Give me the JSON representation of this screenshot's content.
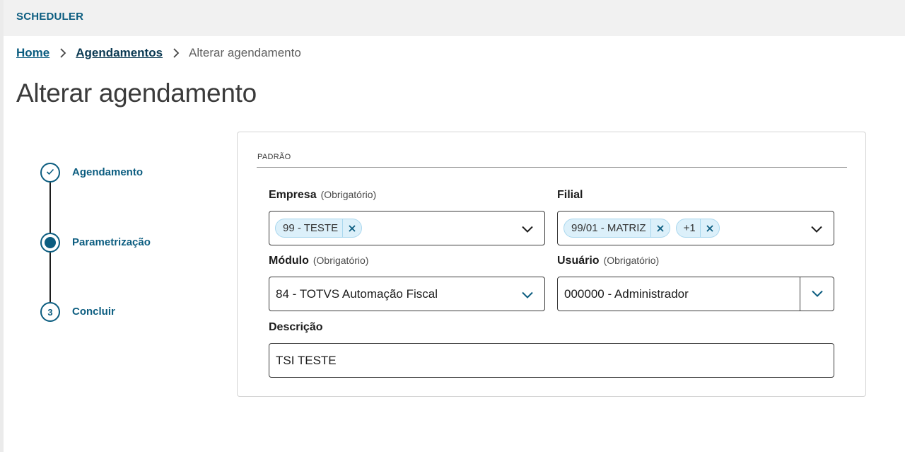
{
  "app": {
    "title": "SCHEDULER"
  },
  "breadcrumb": {
    "home": "Home",
    "agendamentos": "Agendamentos",
    "current": "Alterar agendamento"
  },
  "page": {
    "title": "Alterar agendamento"
  },
  "stepper": {
    "steps": [
      {
        "label": "Agendamento",
        "state": "done",
        "icon": "check-icon"
      },
      {
        "label": "Parametrização",
        "state": "active"
      },
      {
        "label": "Concluir",
        "state": "pending",
        "number": "3"
      }
    ]
  },
  "form": {
    "section": "PADRÃO",
    "empresa": {
      "label": "Empresa",
      "hint": "(Obrigatório)",
      "chips": [
        "99 - TESTE"
      ]
    },
    "filial": {
      "label": "Filial",
      "chips": [
        "99/01 - MATRIZ",
        "+1"
      ]
    },
    "modulo": {
      "label": "Módulo",
      "hint": "(Obrigatório)",
      "value": "84 - TOTVS Automação Fiscal"
    },
    "usuario": {
      "label": "Usuário",
      "hint": "(Obrigatório)",
      "value": "000000 - Administrador"
    },
    "descricao": {
      "label": "Descrição",
      "value": "TSI TESTE"
    }
  },
  "colors": {
    "primary": "#0c5d80",
    "topbar": "#f1f1f1",
    "chip_bg": "#dcf0fa",
    "chip_border": "#a9d7ee"
  }
}
